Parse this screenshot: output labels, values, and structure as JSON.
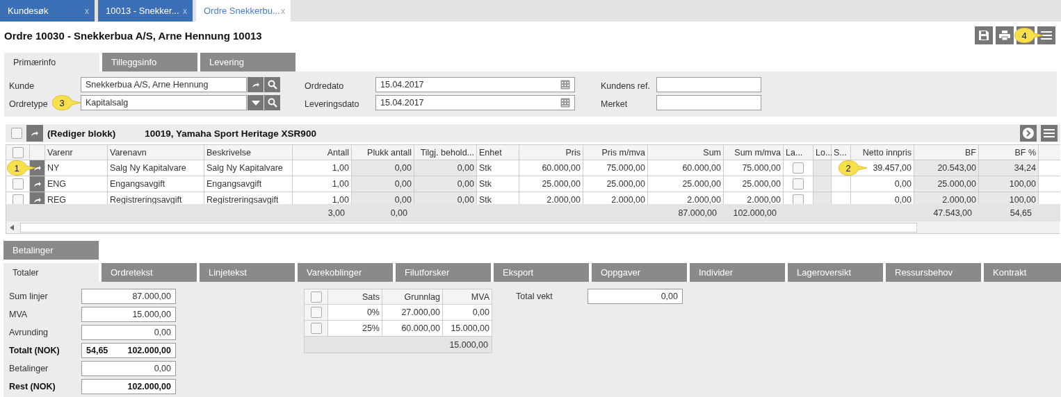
{
  "tabs": [
    {
      "label": "Kundesøk",
      "close": "x",
      "selected": false
    },
    {
      "label": "10013 - Snekker...",
      "close": "x",
      "selected": false
    },
    {
      "label": "Ordre Snekkerbu...",
      "close": "x",
      "selected": true
    }
  ],
  "title": "Ordre 10030 - Snekkerbua A/S, Arne Hennung 10013",
  "toolbar": {
    "callout": "4"
  },
  "form_tabs": [
    {
      "label": "Primærinfo",
      "selected": true
    },
    {
      "label": "Tilleggsinfo",
      "selected": false
    },
    {
      "label": "Levering",
      "selected": false
    }
  ],
  "form": {
    "kunde": {
      "label": "Kunde",
      "value": "Snekkerbua A/S, Arne Hennung"
    },
    "ordretype": {
      "label": "Ordretype",
      "value": "Kapitalsalg",
      "callout": "3"
    },
    "ordredato": {
      "label": "Ordredato",
      "value": "15.04.2017"
    },
    "leveringsdato": {
      "label": "Leveringsdato",
      "value": "15.04.2017"
    },
    "kundens_ref": {
      "label": "Kundens ref."
    },
    "merket": {
      "label": "Merket"
    }
  },
  "block": {
    "checked": false,
    "label": "(Rediger blokk)",
    "title": "10019, Yamaha Sport Heritage XSR900"
  },
  "grid": {
    "header_checked": false,
    "columns": [
      {
        "label": "Varenr",
        "kind": "text"
      },
      {
        "label": "Varenavn",
        "kind": "text"
      },
      {
        "label": "Beskrivelse",
        "kind": "text"
      },
      {
        "label": "Antall",
        "kind": "text",
        "total": "3,00"
      },
      {
        "label": "Plukk antall",
        "kind": "text",
        "total": "0,00"
      },
      {
        "label": "Tilgj. behold...",
        "kind": "text"
      },
      {
        "label": "Enhet",
        "kind": "text"
      },
      {
        "label": "Pris",
        "kind": "text"
      },
      {
        "label": "Pris m/mva",
        "kind": "text"
      },
      {
        "label": "Sum",
        "kind": "text",
        "total": "87.000,00"
      },
      {
        "label": "Sum m/mva",
        "kind": "text",
        "total": "102.000,00"
      },
      {
        "label": "La...",
        "kind": "check"
      },
      {
        "label": "Lo...",
        "kind": "blank"
      },
      {
        "label": "S...",
        "kind": "blank"
      },
      {
        "label": "Netto innpris",
        "kind": "text"
      },
      {
        "label": "BF",
        "kind": "text",
        "total": "47.543,00"
      },
      {
        "label": "BF %",
        "kind": "text",
        "total": "54,65"
      }
    ],
    "rows": [
      {
        "la_checked": false,
        "callout": "1",
        "netto_callout": "2",
        "cells": [
          "NY",
          "Salg Ny Kapitalvare",
          "Salg Ny Kapitalvare",
          "1,00",
          "0,00",
          "0,00",
          "Stk",
          "60.000,00",
          "75.000,00",
          "60.000,00",
          "75.000,00",
          "39.457,00",
          "20.543,00",
          "34,24"
        ]
      },
      {
        "checked": false,
        "la_checked": false,
        "cells": [
          "ENG",
          "Engangsavgift",
          "Engangsavgift",
          "1,00",
          "0,00",
          "0,00",
          "Stk",
          "25.000,00",
          "25.000,00",
          "25.000,00",
          "25.000,00",
          "0,00",
          "25.000,00",
          "100,00"
        ]
      },
      {
        "checked": false,
        "la_checked": false,
        "cells": [
          "REG",
          "Registreringsavgift",
          "Registreringsavgift",
          "1,00",
          "0,00",
          "0,00",
          "Stk",
          "2.000,00",
          "2.000,00",
          "2.000,00",
          "2.000,00",
          "0,00",
          "2.000,00",
          "100,00"
        ]
      }
    ]
  },
  "payments_tab": {
    "label": "Betalinger",
    "selected": false
  },
  "bottom_tabs": [
    {
      "label": "Totaler",
      "selected": true
    },
    {
      "label": "Ordretekst",
      "selected": false
    },
    {
      "label": "Linjetekst",
      "selected": false
    },
    {
      "label": "Varekoblinger",
      "selected": false
    },
    {
      "label": "Filutforsker",
      "selected": false
    },
    {
      "label": "Eksport",
      "selected": false
    },
    {
      "label": "Oppgaver",
      "selected": false
    },
    {
      "label": "Individer",
      "selected": false
    },
    {
      "label": "Lageroversikt",
      "selected": false
    },
    {
      "label": "Ressursbehov",
      "selected": false
    },
    {
      "label": "Kontrakt",
      "selected": false
    }
  ],
  "totals": [
    {
      "label": "Sum linjer",
      "value": "87.000,00",
      "bold": false
    },
    {
      "label": "MVA",
      "value": "15.000,00",
      "bold": false
    },
    {
      "label": "Avrunding",
      "value": "0,00",
      "bold": false
    },
    {
      "label": "Totalt (NOK)",
      "value": "102.000,00",
      "extra": "54,65",
      "bold": true
    },
    {
      "label": "Betalinger",
      "value": "0,00",
      "bold": false
    },
    {
      "label": "Rest (NOK)",
      "value": "102.000,00",
      "bold": true
    }
  ],
  "vat_table": {
    "header_checked": false,
    "columns": [
      "Sats",
      "Grunnlag",
      "MVA"
    ],
    "rows": [
      {
        "checked": false,
        "cells": [
          "0%",
          "27.000,00",
          "0,00"
        ]
      },
      {
        "checked": false,
        "cells": [
          "25%",
          "60.000,00",
          "15.000,00"
        ]
      }
    ],
    "total": "15.000,00"
  },
  "weight": {
    "label": "Total vekt",
    "value": "0,00"
  }
}
